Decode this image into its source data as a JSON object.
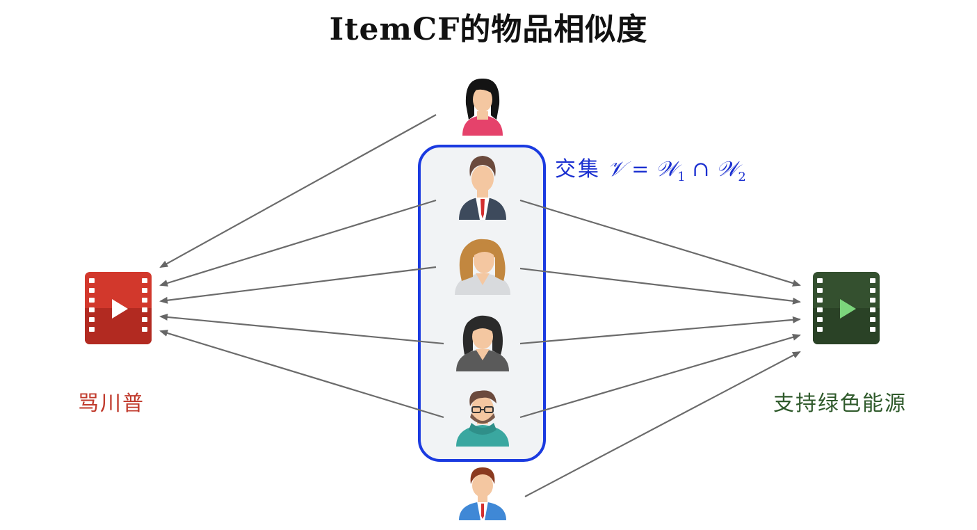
{
  "title": "ItemCF的物品相似度",
  "items": {
    "left": {
      "label": "骂川普",
      "color": "#d2382c"
    },
    "right": {
      "label": "支持绿色能源",
      "color": "#2f4a2b"
    }
  },
  "intersection": {
    "prefix": "交集",
    "set_v": "𝒱",
    "equals": "=",
    "set_w": "𝒲",
    "sub1": "1",
    "cap": "∩",
    "sub2": "2",
    "box_color": "#1a3ae0"
  },
  "users": [
    {
      "id": "top-woman",
      "in_intersection": false,
      "likes_left": true,
      "likes_right": false
    },
    {
      "id": "businessman",
      "in_intersection": true,
      "likes_left": true,
      "likes_right": true
    },
    {
      "id": "blonde-woman",
      "in_intersection": true,
      "likes_left": true,
      "likes_right": true
    },
    {
      "id": "dark-hair-woman",
      "in_intersection": true,
      "likes_left": true,
      "likes_right": true
    },
    {
      "id": "glasses-man",
      "in_intersection": true,
      "likes_left": true,
      "likes_right": true
    },
    {
      "id": "bottom-man",
      "in_intersection": false,
      "likes_left": false,
      "likes_right": true
    }
  ]
}
